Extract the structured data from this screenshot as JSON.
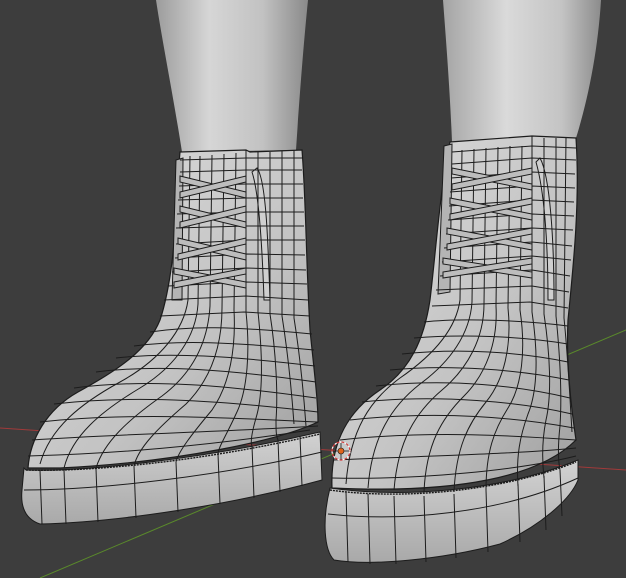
{
  "viewport": {
    "background": "#3d3d3d",
    "grid_floor_color": "#454545",
    "axis_x_color": "#a13a3a",
    "axis_y_color": "#5a8a2b",
    "mesh_fill": "#c9c9c9",
    "mesh_shadow": "#8f8f8f",
    "mesh_highlight": "#e2e2e2",
    "wire_color": "#1c1c1c",
    "selection_color": "#e0641c",
    "icons": {
      "origin": "object-origin-icon",
      "cursor": "3d-cursor-icon"
    }
  }
}
